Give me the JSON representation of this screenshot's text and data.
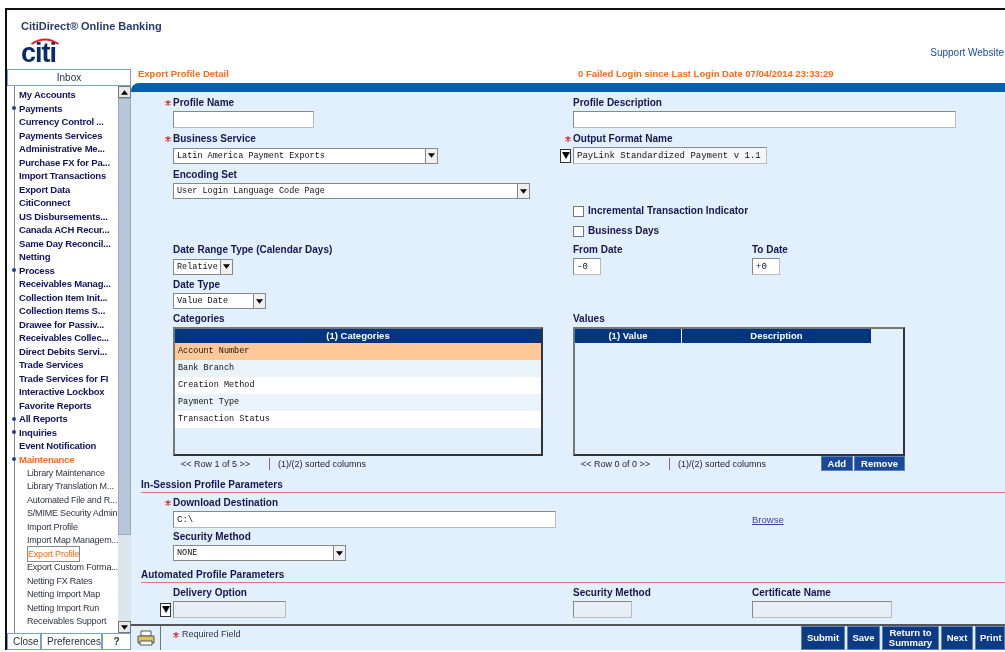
{
  "app": {
    "title": "CitiDirect® Online Banking",
    "logo": "citi",
    "support_link": "Support Website"
  },
  "sidebar": {
    "tab": "Inbox",
    "items": [
      {
        "label": "My Accounts",
        "expandable": false,
        "expanded": false
      },
      {
        "label": "Payments",
        "expandable": true,
        "expanded": false
      },
      {
        "label": "Currency Control ...",
        "expandable": false,
        "expanded": false
      },
      {
        "label": "Payments Services",
        "expandable": false,
        "expanded": false
      },
      {
        "label": "Administrative Me...",
        "expandable": false,
        "expanded": false
      },
      {
        "label": "Purchase FX for Pa...",
        "expandable": false,
        "expanded": false
      },
      {
        "label": "Import Transactions",
        "expandable": false,
        "expanded": false
      },
      {
        "label": "Export Data",
        "expandable": false,
        "expanded": false
      },
      {
        "label": "CitiConnect",
        "expandable": false,
        "expanded": false
      },
      {
        "label": "US Disbursements...",
        "expandable": false,
        "expanded": false
      },
      {
        "label": "Canada ACH Recur...",
        "expandable": false,
        "expanded": false
      },
      {
        "label": "Same Day Reconcil...",
        "expandable": false,
        "expanded": false
      },
      {
        "label": "Netting",
        "expandable": false,
        "expanded": false
      },
      {
        "label": "Process",
        "expandable": true,
        "expanded": false
      },
      {
        "label": "Receivables Manag...",
        "expandable": false,
        "expanded": false
      },
      {
        "label": "Collection Item Init...",
        "expandable": false,
        "expanded": false
      },
      {
        "label": "Collection Items S...",
        "expandable": false,
        "expanded": false
      },
      {
        "label": "Drawee for Passiv...",
        "expandable": false,
        "expanded": false
      },
      {
        "label": "Receivables Collec...",
        "expandable": false,
        "expanded": false
      },
      {
        "label": "Direct Debits Servi...",
        "expandable": false,
        "expanded": false
      },
      {
        "label": "Trade Services",
        "expandable": false,
        "expanded": false
      },
      {
        "label": "Trade Services for FI",
        "expandable": false,
        "expanded": false
      },
      {
        "label": "Interactive Lockbox",
        "expandable": false,
        "expanded": false
      },
      {
        "label": "Favorite Reports",
        "expandable": false,
        "expanded": false
      },
      {
        "label": "All Reports",
        "expandable": true,
        "expanded": false
      },
      {
        "label": "Inquiries",
        "expandable": true,
        "expanded": false
      },
      {
        "label": "Event Notification",
        "expandable": false,
        "expanded": false
      },
      {
        "label": "Maintenance",
        "expandable": true,
        "expanded": true,
        "children": [
          {
            "label": "Library Maintenance",
            "selected": false
          },
          {
            "label": "Library Translation M...",
            "selected": false
          },
          {
            "label": "Automated File and R...",
            "selected": false
          },
          {
            "label": "S/MIME Security Admin",
            "selected": false
          },
          {
            "label": "Import Profile",
            "selected": false
          },
          {
            "label": "Import Map Managem...",
            "selected": false
          },
          {
            "label": "Export Profile",
            "selected": true
          },
          {
            "label": "Export Custom Forma...",
            "selected": false
          },
          {
            "label": "Netting FX Rates",
            "selected": false
          },
          {
            "label": "Netting Import Map",
            "selected": false
          },
          {
            "label": "Netting Import Run",
            "selected": false
          },
          {
            "label": "Receivables Support",
            "selected": false
          }
        ]
      }
    ],
    "buttons": [
      "Close",
      "Preferences",
      "?"
    ]
  },
  "page_title": "Export Profile Detail",
  "login_info": "0  Failed Login since  Last Login Date  07/04/2014 23:33:29",
  "form": {
    "profile_name": {
      "label": "Profile Name",
      "required": true
    },
    "profile_description": {
      "label": "Profile Description"
    },
    "business_service": {
      "label": "Business Service",
      "required": true,
      "value": "Latin America Payment Exports"
    },
    "output_format_name": {
      "label": "Output Format Name",
      "required": true,
      "value": "PayLink Standardized Payment v 1.1"
    },
    "encoding_set": {
      "label": "Encoding Set",
      "value": "User Login Language Code Page"
    },
    "incremental_transaction_indicator": {
      "label": "Incremental Transaction Indicator",
      "checked": false
    },
    "business_days": {
      "label": "Business Days",
      "checked": false
    },
    "date_range_type": {
      "label": "Date Range Type (Calendar Days)",
      "value": "Relative"
    },
    "from_date": {
      "label": "From Date",
      "value": "-0"
    },
    "to_date": {
      "label": "To Date",
      "value": "+0"
    },
    "date_type": {
      "label": "Date Type",
      "value": "Value Date"
    },
    "categories": {
      "label": "Categories",
      "column": "(1) Categories",
      "rows": [
        {
          "text": "Account Number",
          "selected": true
        },
        {
          "text": "Bank Branch",
          "selected": false
        },
        {
          "text": "Creation Method",
          "selected": false
        },
        {
          "text": "Payment Type",
          "selected": false
        },
        {
          "text": "Transaction Status",
          "selected": false
        }
      ],
      "pager": "<< Row 1 of 5 >>",
      "sort_info": "(1)/(2) sorted columns"
    },
    "values": {
      "label": "Values",
      "columns": [
        "(1) Value",
        "Description"
      ],
      "pager": "<< Row 0 of 0 >>",
      "sort_info": "(1)/(2) sorted columns",
      "buttons": [
        "Add",
        "Remove"
      ]
    }
  },
  "in_session": {
    "heading": "In-Session Profile Parameters",
    "download_destination": {
      "label": "Download Destination",
      "required": true,
      "value": "C:\\"
    },
    "browse_link": "Browse",
    "security_method": {
      "label": "Security Method",
      "value": "NONE"
    }
  },
  "automated": {
    "heading": "Automated Profile Parameters",
    "delivery_option": {
      "label": "Delivery Option"
    },
    "security_method": {
      "label": "Security Method"
    },
    "certificate_name": {
      "label": "Certificate Name"
    }
  },
  "footer": {
    "required_note": "Required Field",
    "buttons": [
      "Submit",
      "Save",
      "Return to Summary",
      "Next",
      "Print"
    ]
  }
}
